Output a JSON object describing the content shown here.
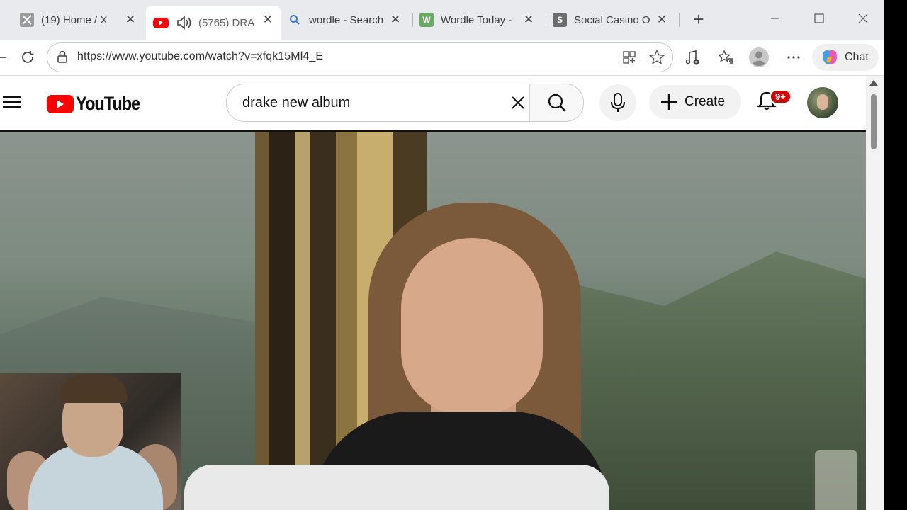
{
  "browser": {
    "tabs": [
      {
        "title": "(19) Home / X",
        "icon": "x-logo-icon",
        "active": false
      },
      {
        "title": "(5765) DRA",
        "icon": "youtube-favicon-icon",
        "active": true
      },
      {
        "title": "wordle - Search",
        "icon": "search-icon",
        "active": false
      },
      {
        "title": "Wordle Today -",
        "icon": "w-favicon-icon",
        "active": false
      },
      {
        "title": "Social Casino O",
        "icon": "s-favicon-icon",
        "active": false
      }
    ],
    "url": "https://www.youtube.com/watch?v=xfqk15Ml4_E",
    "chat_label": "Chat"
  },
  "youtube": {
    "logo_text": "YouTube",
    "search_value": "drake new album",
    "create_label": "Create",
    "notification_count": "9+"
  },
  "colors": {
    "youtube_red": "#ff0000",
    "badge_red": "#cc0000",
    "tabbar_bg": "#e8eaed"
  }
}
